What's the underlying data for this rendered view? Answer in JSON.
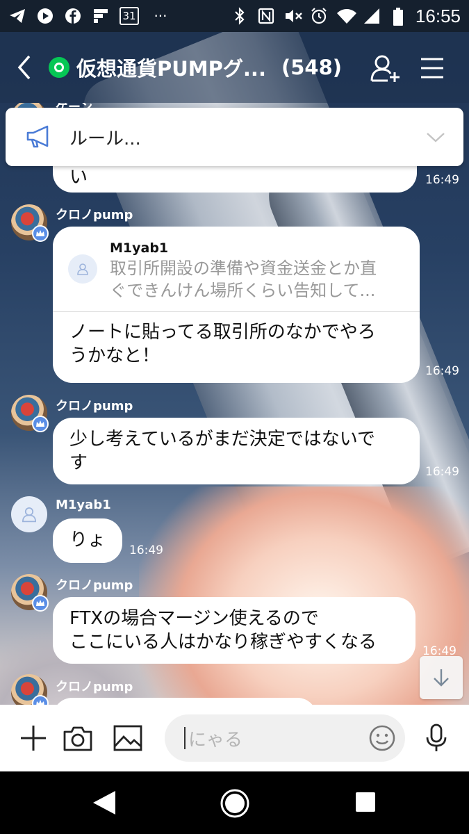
{
  "status_bar": {
    "time": "16:55",
    "left_icons": [
      "telegram-icon",
      "youtube-icon",
      "facebook-icon",
      "flipboard-icon",
      "calendar-icon",
      "more-icon"
    ],
    "calendar_day": "31",
    "more": "···",
    "right_icons": [
      "bluetooth-icon",
      "nfc-icon",
      "mute-icon",
      "alarm-icon",
      "wifi-icon",
      "signal-icon",
      "battery-icon"
    ]
  },
  "header": {
    "title": "仮想通貨PUMPグ...",
    "member_count": "(548)"
  },
  "announcement": {
    "text": "ルール..."
  },
  "messages": [
    {
      "type": "partial",
      "text": "い",
      "time": "16:49"
    },
    {
      "type": "reply",
      "sender": "クロノpump",
      "reply_to_name": "M1yab1",
      "reply_to_text_1": "取引所開設の準備や資金送金とか直",
      "reply_to_text_2": "ぐできんけん場所くらい告知して...",
      "text_1": "ノートに貼ってる取引所のなかでやろ",
      "text_2": "うかなと！",
      "time": "16:49"
    },
    {
      "type": "text",
      "sender": "クロノpump",
      "text_1": "少し考えているがまだ決定ではないで",
      "text_2": "す",
      "time": "16:49"
    },
    {
      "type": "text",
      "sender": "M1yab1",
      "text_1": "りょ",
      "time": "16:49"
    },
    {
      "type": "text",
      "sender": "クロノpump",
      "text_1": "FTXの場合マージン使えるので",
      "text_2": "ここにいる人はかなり稼ぎやすくなる",
      "time": "16:49"
    },
    {
      "type": "text",
      "sender": "クロノpump"
    }
  ],
  "input": {
    "placeholder": "にゃる"
  }
}
